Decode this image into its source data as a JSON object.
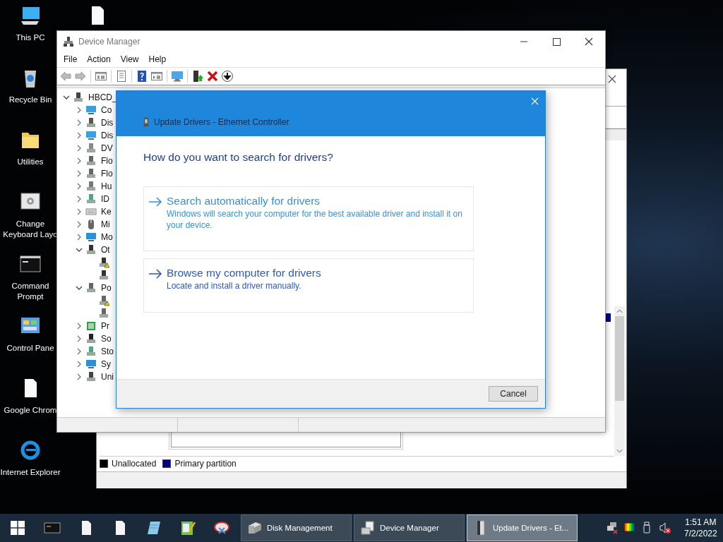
{
  "desktop_icons": [
    {
      "kind": "pc",
      "lines": [
        "This PC"
      ]
    },
    {
      "kind": "recycle",
      "lines": [
        "Recycle Bin"
      ]
    },
    {
      "kind": "folder",
      "lines": [
        "Utilities"
      ]
    },
    {
      "kind": "settings",
      "lines": [
        "Change",
        "Keyboard Layo"
      ]
    },
    {
      "kind": "cmd",
      "lines": [
        "Command",
        "Prompt"
      ]
    },
    {
      "kind": "control",
      "lines": [
        "Control Pane"
      ]
    },
    {
      "kind": "file",
      "lines": [
        "Google Chrom"
      ]
    },
    {
      "kind": "ie",
      "lines": [
        "Internet Explorer"
      ]
    }
  ],
  "desktop_files": [
    {
      "kind": "file"
    }
  ],
  "disk_management": {
    "legend": [
      {
        "label": "Unallocated",
        "color": "#000000"
      },
      {
        "label": "Primary partition",
        "color": "#00007f"
      }
    ]
  },
  "device_manager": {
    "title": "Device Manager",
    "menu": [
      "File",
      "Action",
      "View",
      "Help"
    ],
    "tree": {
      "label": "HBCD_",
      "kind": "root",
      "expanded": true,
      "children": [
        {
          "label": "Co",
          "kind": "computer",
          "expanded": false
        },
        {
          "label": "Dis",
          "kind": "disk",
          "expanded": false
        },
        {
          "label": "Dis",
          "kind": "display",
          "expanded": false
        },
        {
          "label": "DV",
          "kind": "dvd",
          "expanded": false
        },
        {
          "label": "Flo",
          "kind": "floppy",
          "expanded": false
        },
        {
          "label": "Flo",
          "kind": "floppy",
          "expanded": false
        },
        {
          "label": "Hu",
          "kind": "hid",
          "expanded": false
        },
        {
          "label": "ID",
          "kind": "ide",
          "expanded": false
        },
        {
          "label": "Ke",
          "kind": "keyboard",
          "expanded": false
        },
        {
          "label": "Mi",
          "kind": "mouse",
          "expanded": false
        },
        {
          "label": "Mo",
          "kind": "monitor",
          "expanded": false
        },
        {
          "label": "Ot",
          "kind": "other",
          "expanded": true,
          "children": [
            {
              "kind": "other",
              "warning": true
            },
            {
              "kind": "other",
              "warning": false
            }
          ]
        },
        {
          "label": "Po",
          "kind": "port",
          "expanded": true,
          "children": [
            {
              "kind": "port",
              "warning": true
            },
            {
              "kind": "port",
              "warning": false
            }
          ]
        },
        {
          "label": "Pr",
          "kind": "cpu",
          "expanded": false
        },
        {
          "label": "So",
          "kind": "software",
          "expanded": false
        },
        {
          "label": "Sto",
          "kind": "storage",
          "expanded": false
        },
        {
          "label": "Sy",
          "kind": "system",
          "expanded": false
        },
        {
          "label": "Uni",
          "kind": "usb",
          "expanded": false
        }
      ]
    }
  },
  "dialog": {
    "title": "Update Drivers - Ethernet Controller",
    "heading": "How do you want to search for drivers?",
    "options": [
      {
        "title": "Search automatically for drivers",
        "description": "Windows will search your computer for the best available driver and install it on your device.",
        "hovered": false
      },
      {
        "title": "Browse my computer for drivers",
        "description": "Locate and install a driver manually.",
        "hovered": true
      }
    ],
    "buttons": [
      "Cancel"
    ]
  },
  "taskbar": {
    "pinned": [
      {
        "kind": "cmd"
      },
      {
        "kind": "file"
      },
      {
        "kind": "file"
      },
      {
        "kind": "notepad"
      },
      {
        "kind": "editor"
      },
      {
        "kind": "snip"
      }
    ],
    "windows": [
      {
        "label": "Disk Management",
        "kind": "disk",
        "selected": false
      },
      {
        "label": "Device Manager",
        "kind": "devmgr",
        "selected": false
      },
      {
        "label": "Update Drivers - Et...",
        "kind": "driver",
        "selected": true
      }
    ],
    "clock": {
      "time": "1:51 AM",
      "date": "7/2/2022"
    }
  }
}
